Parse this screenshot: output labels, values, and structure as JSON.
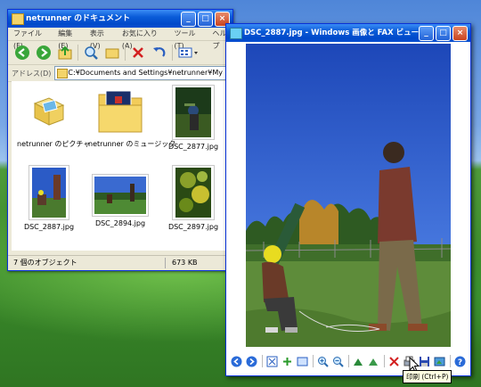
{
  "explorer": {
    "title": "netrunner のドキュメント",
    "menu": [
      "ファイル(F)",
      "編集(E)",
      "表示(V)",
      "お気に入り(A)",
      "ツール(T)",
      "ヘルプ"
    ],
    "address_label": "アドレス(D)",
    "address_value": "C:¥Documents and Settings¥netrunner¥My Documents",
    "items": [
      {
        "label": "netrunner のピクチャ",
        "icon": "pictures-folder-icon"
      },
      {
        "label": "netrunner のミュージック",
        "icon": "music-folder-icon"
      },
      {
        "label": "DSC_2877.jpg",
        "icon": "photo-thumbnail-icon"
      },
      {
        "label": "DSC_2887.jpg",
        "icon": "photo-thumbnail-icon"
      },
      {
        "label": "DSC_2894.jpg",
        "icon": "photo-thumbnail-icon"
      },
      {
        "label": "DSC_2897.jpg",
        "icon": "photo-thumbnail-icon"
      }
    ],
    "status_left": "7 個のオブジェクト",
    "status_right": "673 KB"
  },
  "viewer": {
    "title": "DSC_2887.jpg - Windows 画像と FAX ビューア",
    "tooltip": "印刷 (Ctrl+P)"
  },
  "colors": {
    "title_bar": "#0a5bd8",
    "close_button": "#c9431f",
    "window_bg": "#ece9d8"
  }
}
